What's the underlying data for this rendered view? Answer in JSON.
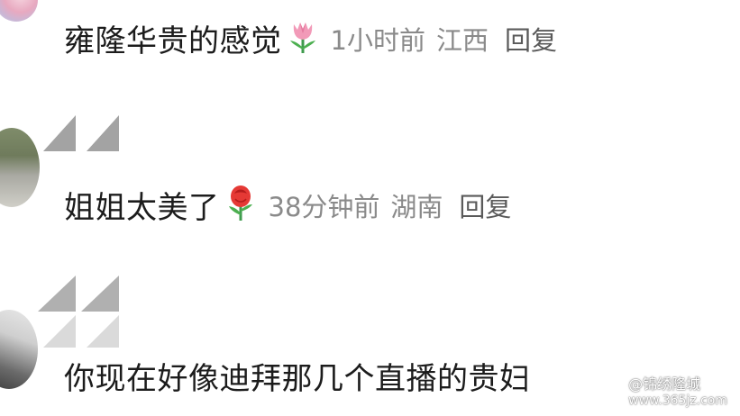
{
  "comments": [
    {
      "text": "雍隆华贵的感觉",
      "emoji": "tulip-emoji",
      "time": "1小时前",
      "location": "江西",
      "reply": "回复"
    },
    {
      "text": "姐姐太美了",
      "emoji": "rose-emoji",
      "time": "38分钟前",
      "location": "湖南",
      "reply": "回复"
    },
    {
      "text": "你现在好像迪拜那几个直播的贵妇"
    }
  ],
  "watermark": {
    "name": "@锦绣隆城",
    "url": "www.365jz.com",
    "icon": "watermark-logo-icon"
  },
  "colors": {
    "text": "#1c1c1c",
    "meta": "#8a8a8a",
    "reply": "#5a5a5a",
    "quote_gray": "#9e9e9e"
  }
}
